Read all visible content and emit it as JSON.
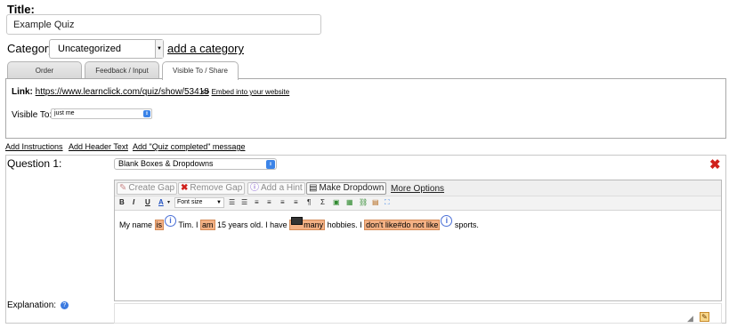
{
  "title": {
    "label": "Title:",
    "value": "Example Quiz"
  },
  "category": {
    "label": "Category:",
    "value": "Uncategorized",
    "add_link": "add a category"
  },
  "tabs": [
    {
      "label": "Order"
    },
    {
      "label": "Feedback / Input"
    },
    {
      "label": "Visible To / Share"
    }
  ],
  "share": {
    "link_label": "Link:",
    "link_url": "https://www.learnclick.com/quiz/show/53418",
    "embed_symbol": "<>",
    "embed_text": "Embed into your website",
    "visible_label": "Visible To:",
    "visible_value": "just me"
  },
  "add_links": {
    "instructions": "Add Instructions",
    "header_text": "Add Header Text",
    "completed_message": "Add \"Quiz completed\" message"
  },
  "question": {
    "label": "Question 1:",
    "type_value": "Blank Boxes & Dropdowns",
    "close_symbol": "✖",
    "toolbar": {
      "create_gap": "Create Gap",
      "remove_gap": "Remove Gap",
      "add_hint": "Add a Hint",
      "make_dropdown": "Make Dropdown",
      "more_options": "More Options"
    },
    "format_toolbar": {
      "bold": "B",
      "italic": "I",
      "underline": "U",
      "font_color": "A",
      "font_size": "Font size"
    },
    "content": {
      "t1": "My name ",
      "gap1": "is",
      "t2": " Tim. I ",
      "gap2": "am",
      "t3": " 15 years old. I have ",
      "gap3": "many",
      "t4": " hobbies. I ",
      "gap4": "don't like#do not like",
      "t5": " sports."
    }
  },
  "explanation": {
    "label": "Explanation:"
  },
  "icons": {
    "hint": "info-icon",
    "dropdown": "dropdown-icon",
    "close": "red-x-icon",
    "help": "question-mark-icon"
  },
  "colors": {
    "gap_fill": "#f4b184",
    "close_red": "#d0211c",
    "accent_blue": "#3c84e8"
  }
}
